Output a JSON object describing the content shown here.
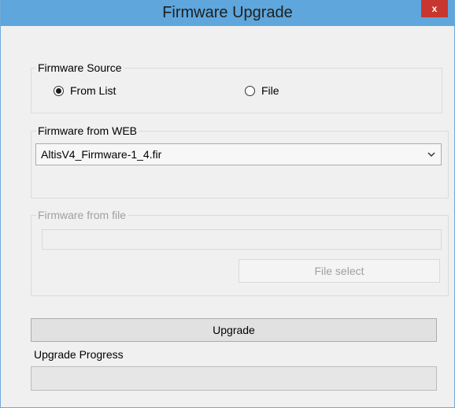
{
  "window": {
    "title": "Firmware Upgrade",
    "close_label": "x"
  },
  "source": {
    "legend": "Firmware Source",
    "options": [
      {
        "label": "From List",
        "checked": true
      },
      {
        "label": "File",
        "checked": false
      }
    ]
  },
  "web": {
    "legend": "Firmware from WEB",
    "selected": "AltisV4_Firmware-1_4.fir"
  },
  "file": {
    "legend": "Firmware from file",
    "path": "",
    "select_button": "File select"
  },
  "upgrade_button": "Upgrade",
  "progress": {
    "label": "Upgrade Progress",
    "value": 0
  }
}
